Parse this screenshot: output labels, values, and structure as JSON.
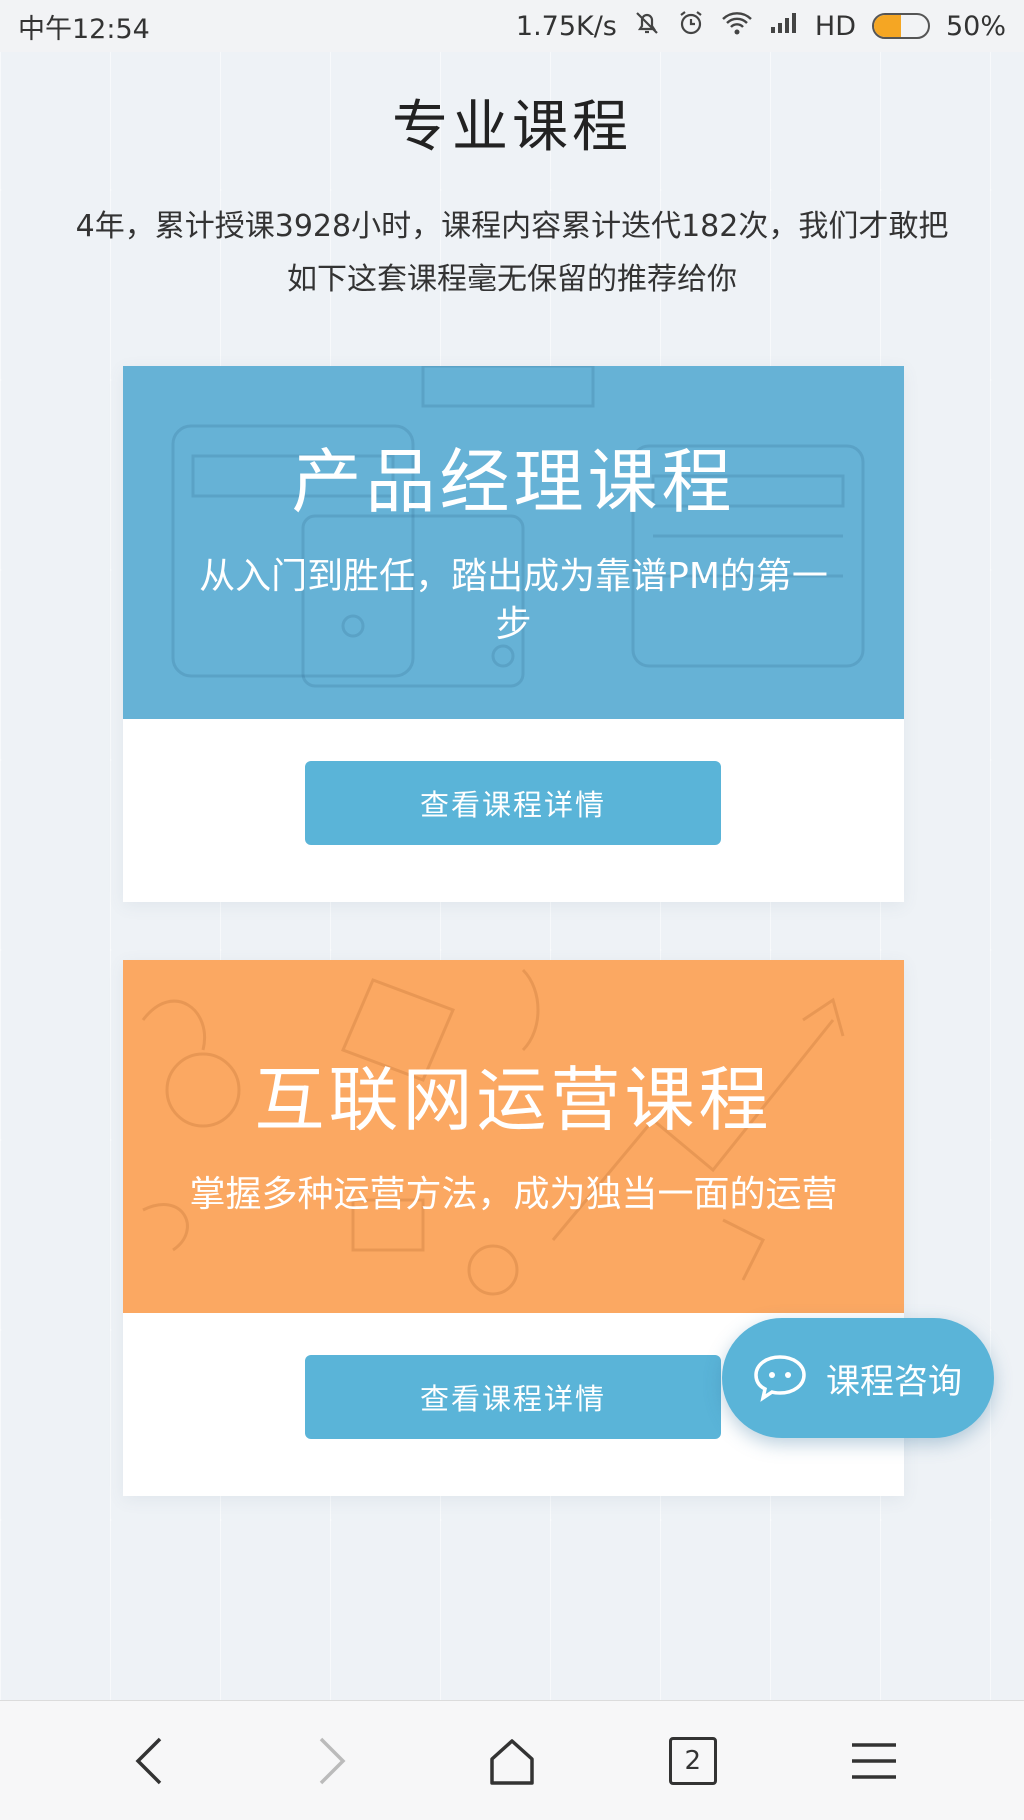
{
  "status_bar": {
    "time": "中午12:54",
    "speed": "1.75K/s",
    "network": "HD",
    "battery": "50%",
    "battery_level": 0.5
  },
  "header": {
    "title": "专业课程",
    "intro_line1": "4年，累计授课3928小时，课程内容累计迭代182次，我们才敢把",
    "intro_line2": "如下这套课程毫无保留的推荐给你"
  },
  "courses": [
    {
      "title": "产品经理课程",
      "subtitle": "从入门到胜任，踏出成为靠谱PM的第一步",
      "button_label": "查看课程详情",
      "color": "#66b2d6"
    },
    {
      "title": "互联网运营课程",
      "subtitle": "掌握多种运营方法，成为独当一面的运营",
      "button_label": "查看课程详情",
      "color": "#fba862"
    }
  ],
  "consult": {
    "label": "课程咨询",
    "icon": "chat-bubble-icon"
  },
  "bottom_nav": {
    "tabs_count": "2",
    "icons": [
      "back-icon",
      "forward-icon",
      "home-icon",
      "tabs-icon",
      "menu-icon"
    ]
  },
  "colors": {
    "accent": "#5ab4d8",
    "pm_banner": "#66b2d6",
    "ops_banner": "#fba862"
  }
}
